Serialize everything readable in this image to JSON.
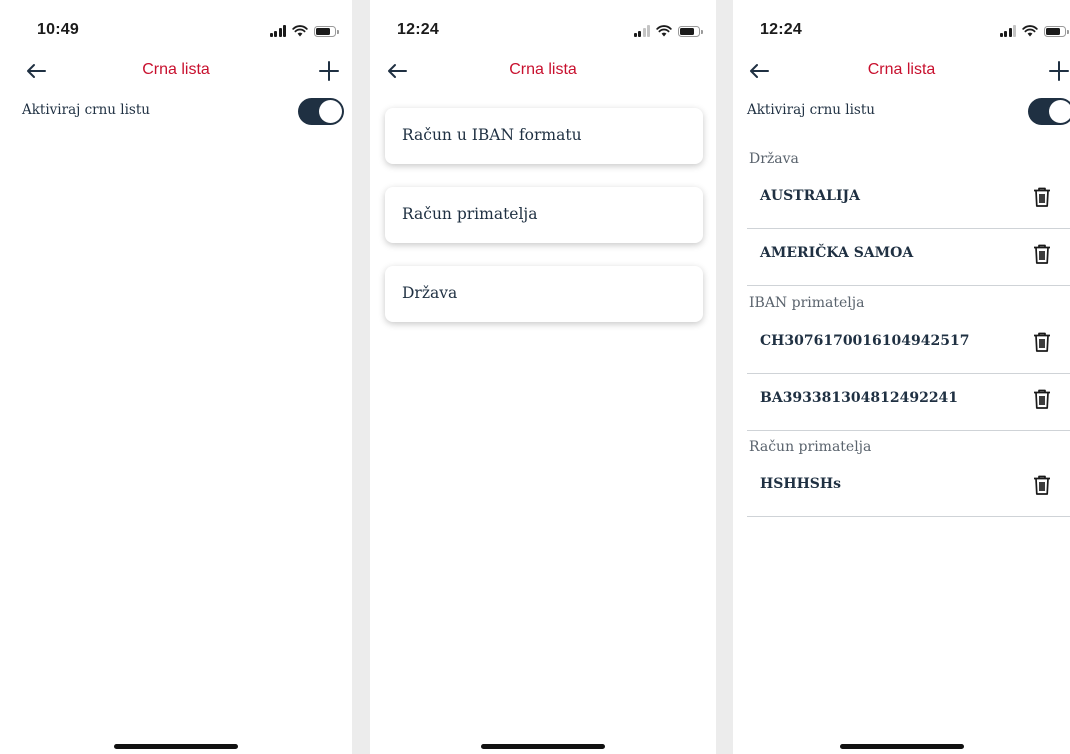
{
  "colors": {
    "accent": "#c8102e",
    "navy": "#1f3042",
    "divider": "#cfd3d7"
  },
  "icons": {
    "back": "arrow-left-icon",
    "add": "plus-icon",
    "delete": "trash-icon",
    "signal": "signal-icon",
    "wifi": "wifi-icon",
    "battery": "battery-icon"
  },
  "screen1": {
    "time": "10:49",
    "title": "Crna lista",
    "toggle_label": "Aktiviraj crnu listu",
    "toggle_on": true
  },
  "screen2": {
    "time": "12:24",
    "title": "Crna lista",
    "options": [
      "Račun u IBAN formatu",
      "Račun primatelja",
      "Država"
    ]
  },
  "screen3": {
    "time": "12:24",
    "title": "Crna lista",
    "toggle_label": "Aktiviraj crnu listu",
    "toggle_on": true,
    "sections": [
      {
        "header": "Država",
        "items": [
          "AUSTRALIJA",
          "AMERIČKA SAMOA"
        ]
      },
      {
        "header": "IBAN primatelja",
        "items": [
          "CH3076170016104942517",
          "BA393381304812492241"
        ]
      },
      {
        "header": "Račun primatelja",
        "items": [
          "HSHHSHs"
        ]
      }
    ]
  }
}
